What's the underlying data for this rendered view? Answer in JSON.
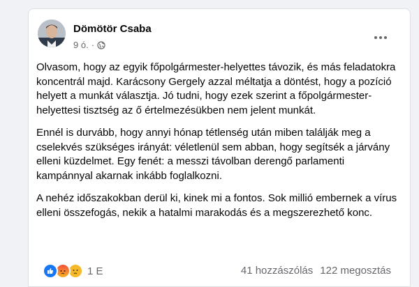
{
  "post": {
    "author": "Dömötör Csaba",
    "time": "9 ó.",
    "audience_icon": "globe-icon",
    "paragraphs": [
      "Olvasom, hogy az egyik főpolgármester-helyettes távozik, és más feladatokra koncentrál majd. Karácsony Gergely azzal méltatja a döntést, hogy a pozíció helyett a munkát választja. Jó tudni, hogy ezek szerint a főpolgármester-helyettesi tisztség az ő értelmezésükben nem jelent munkát.",
      "Ennél is durvább, hogy annyi hónap tétlenség után miben találják meg a cselekvés szükséges irányát: véletlenül sem abban, hogy segítsék a járvány elleni küzdelmet. Egy fenét: a messzi távolban derengő parlamenti kampánnyal akarnak inkább foglalkozni.",
      "A nehéz időszakokban derül ki, kinek mi a fontos. Sok millió embernek a vírus elleni összefogás, nekik a hatalmi marakodás és a megszerezhető konc."
    ],
    "reactions": {
      "icons": [
        "like-icon",
        "angry-icon",
        "sad-icon"
      ],
      "count": "1 E"
    },
    "comments": "41 hozzászólás",
    "shares": "122 megosztás"
  }
}
